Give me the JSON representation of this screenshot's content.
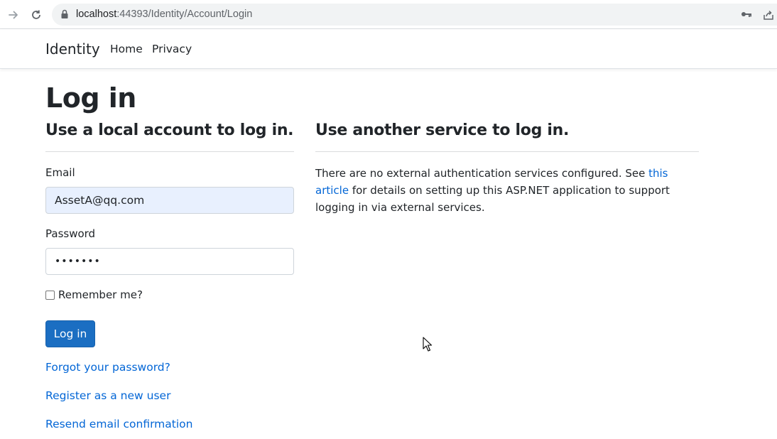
{
  "browser": {
    "url_host": "localhost",
    "url_rest": ":44393/Identity/Account/Login"
  },
  "navbar": {
    "brand": "Identity",
    "links": [
      "Home",
      "Privacy"
    ]
  },
  "page": {
    "title": "Log in",
    "local_heading": "Use a local account to log in.",
    "external_heading": "Use another service to log in."
  },
  "form": {
    "email_label": "Email",
    "email_value": "AssetA@qq.com",
    "password_label": "Password",
    "password_value": "•••••••",
    "remember_label": "Remember me?",
    "remember_checked": false,
    "submit_label": "Log in"
  },
  "links": {
    "forgot": "Forgot your password?",
    "register": "Register as a new user",
    "resend": "Resend email confirmation"
  },
  "external": {
    "text_before": "There are no external authentication services configured. See ",
    "link_text": "this article",
    "text_after": " for details on setting up this ASP.NET application to support logging in via external services."
  },
  "colors": {
    "primary_button": "#1b6ec2",
    "link": "#0366d6",
    "autofill_bg": "#e8f0fe"
  }
}
